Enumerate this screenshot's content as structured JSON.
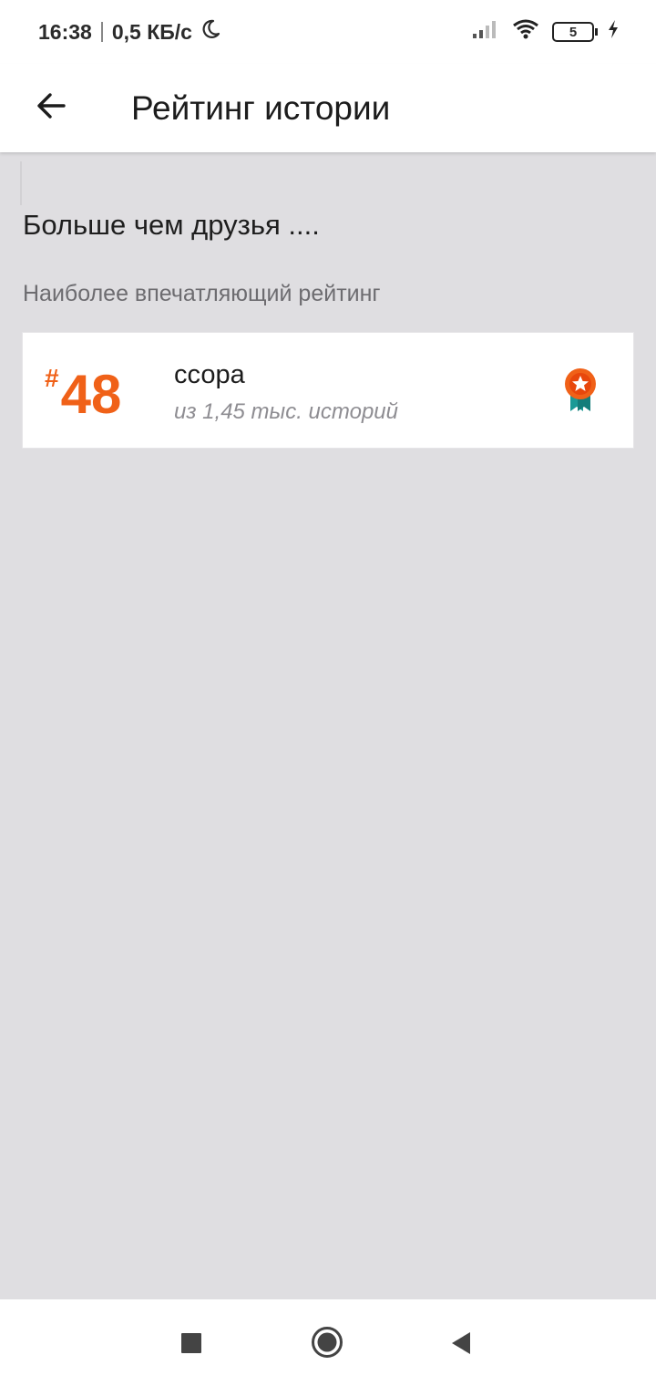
{
  "status_bar": {
    "time": "16:38",
    "speed": "0,5 КБ/с",
    "battery": "5"
  },
  "app_bar": {
    "title": "Рейтинг истории",
    "back_icon": "arrow-left-icon"
  },
  "section": {
    "title": "Больше чем друзья ....",
    "subtitle": "Наиболее впечатляющий рейтинг"
  },
  "rank_card": {
    "hash": "#",
    "rank": "48",
    "tag": "ссора",
    "total": "из 1,45 тыс. историй",
    "icon": "medal-icon"
  },
  "nav": {
    "recents_icon": "square-icon",
    "home_icon": "circle-icon",
    "back_icon": "triangle-back-icon"
  },
  "colors": {
    "accent": "#f06118",
    "medal_ribbon": "#1a9a96",
    "background": "#dfdee1"
  }
}
